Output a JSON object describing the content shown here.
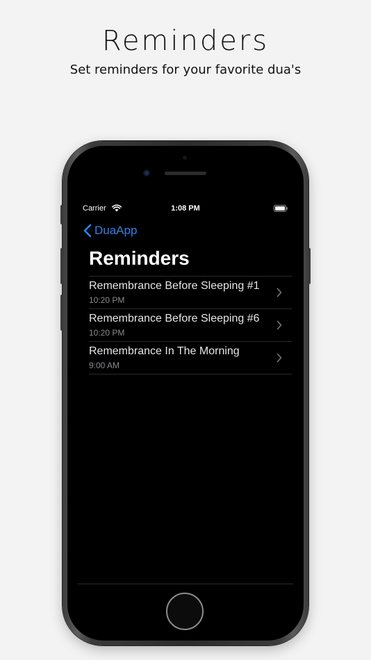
{
  "promo": {
    "title": "Reminders",
    "subtitle": "Set reminders for your favorite dua's"
  },
  "status_bar": {
    "carrier": "Carrier",
    "time": "1:08 PM"
  },
  "nav": {
    "back_label": "DuaApp",
    "title": "Reminders"
  },
  "reminders": [
    {
      "title": "Remembrance Before Sleeping #1",
      "time": "10:20 PM"
    },
    {
      "title": "Remembrance Before Sleeping #6",
      "time": "10:20 PM"
    },
    {
      "title": "Remembrance In The Morning",
      "time": "9:00 AM"
    }
  ],
  "colors": {
    "accent": "#2f80ed",
    "screen_background": "#000000",
    "page_background": "#f3f3f3"
  }
}
